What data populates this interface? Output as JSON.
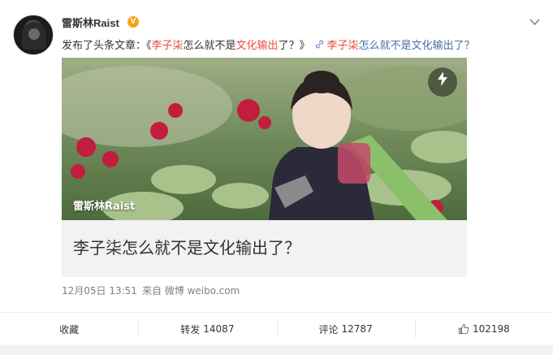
{
  "user": {
    "name": "雷斯林Raist",
    "verified_badge": "V"
  },
  "post": {
    "prefix": "发布了头条文章：《",
    "title_red": "李子柒",
    "title_mid": "怎么就不是",
    "title_red2": "文化输出",
    "title_end": "了？》",
    "link_icon": "🔗",
    "link_red": "李子柒",
    "link_mid": "怎么就不是",
    "link_blue": "文化输出",
    "link_end": "了？"
  },
  "article": {
    "cover_author": "雷斯林Raist",
    "title": "李子柒怎么就不是文化输出了？",
    "flash_icon": "⚡"
  },
  "meta": {
    "date": "12月05日 13:51",
    "source": "来自 微博 weibo.com"
  },
  "actions": {
    "collect": "收藏",
    "repost_label": "转发",
    "repost_count": "14087",
    "comment_label": "评论",
    "comment_count": "12787",
    "like_count": "102198"
  },
  "icons": {
    "more": "chevron-down-icon",
    "link": "link-icon",
    "flash": "lightning-icon",
    "like": "thumbs-up-icon"
  }
}
